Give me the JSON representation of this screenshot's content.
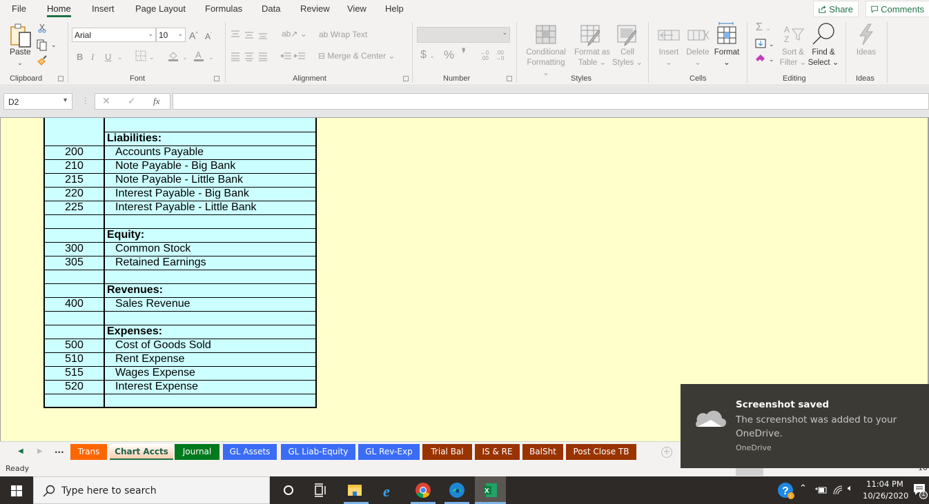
{
  "menu": {
    "tabs": [
      "File",
      "Home",
      "Insert",
      "Page Layout",
      "Formulas",
      "Data",
      "Review",
      "View",
      "Help"
    ],
    "active": "Home",
    "share_label": "Share",
    "comments_label": "Comments"
  },
  "ribbon": {
    "clipboard": {
      "paste_label": "Paste",
      "group_label": "Clipboard"
    },
    "font": {
      "font_name": "Arial",
      "font_size": "10",
      "group_label": "Font"
    },
    "alignment": {
      "wrap_text_label": "Wrap Text",
      "merge_center_label": "Merge & Center",
      "group_label": "Alignment"
    },
    "number": {
      "format_value": "",
      "currency_symbol": "$",
      "percent_symbol": "%",
      "comma_symbol": "❜",
      "group_label": "Number"
    },
    "styles": {
      "conditional_formatting_label_1": "Conditional",
      "conditional_formatting_label_2": "Formatting",
      "format_as_table_label_1": "Format as",
      "format_as_table_label_2": "Table",
      "cell_styles_label_1": "Cell",
      "cell_styles_label_2": "Styles",
      "group_label": "Styles"
    },
    "cells": {
      "insert_label": "Insert",
      "delete_label": "Delete",
      "format_label": "Format",
      "group_label": "Cells"
    },
    "editing": {
      "sort_filter_label_1": "Sort &",
      "sort_filter_label_2": "Filter",
      "find_select_label_1": "Find &",
      "find_select_label_2": "Select",
      "group_label": "Editing"
    },
    "ideas": {
      "ideas_label": "Ideas",
      "group_label": "Ideas"
    }
  },
  "formula_bar": {
    "name_box": "D2",
    "cancel_symbol": "✕",
    "enter_symbol": "✓",
    "fx_symbol": "fx",
    "formula_value": ""
  },
  "sheet": {
    "background_color": "#ffffcc",
    "table_color": "#ccffff",
    "rows": [
      {
        "num": "",
        "name": "",
        "type": "blank"
      },
      {
        "num": "",
        "name": "Liabilities:",
        "type": "header"
      },
      {
        "num": "200",
        "name": "Accounts Payable",
        "type": "account"
      },
      {
        "num": "210",
        "name": "Note Payable - Big Bank",
        "type": "account"
      },
      {
        "num": "215",
        "name": "Note Payable - Little Bank",
        "type": "account"
      },
      {
        "num": "220",
        "name": "Interest Payable - Big Bank",
        "type": "account"
      },
      {
        "num": "225",
        "name": "Interest Payable - Little Bank",
        "type": "account"
      },
      {
        "num": "",
        "name": "",
        "type": "blank"
      },
      {
        "num": "",
        "name": "Equity:",
        "type": "header"
      },
      {
        "num": "300",
        "name": "Common Stock",
        "type": "account"
      },
      {
        "num": "305",
        "name": "Retained Earnings",
        "type": "account"
      },
      {
        "num": "",
        "name": "",
        "type": "blank"
      },
      {
        "num": "",
        "name": "Revenues:",
        "type": "header"
      },
      {
        "num": "400",
        "name": "Sales Revenue",
        "type": "account"
      },
      {
        "num": "",
        "name": "",
        "type": "blank"
      },
      {
        "num": "",
        "name": "Expenses:",
        "type": "header"
      },
      {
        "num": "500",
        "name": "Cost of Goods Sold",
        "type": "account"
      },
      {
        "num": "510",
        "name": "Rent Expense",
        "type": "account"
      },
      {
        "num": "515",
        "name": "Wages Expense",
        "type": "account"
      },
      {
        "num": "520",
        "name": "Interest Expense",
        "type": "account"
      },
      {
        "num": "",
        "name": "",
        "type": "blank"
      }
    ]
  },
  "sheet_tabs": {
    "ellipsis": "...",
    "tabs": [
      {
        "label": "Trans",
        "color": "#ff6600",
        "active": false
      },
      {
        "label": "Chart Accts",
        "color": "#f8cfb0",
        "active": true
      },
      {
        "label": "Journal",
        "color": "#007a1c",
        "active": false
      },
      {
        "label": "GL Assets",
        "color": "#3b6cf5",
        "active": false
      },
      {
        "label": "GL Liab-Equity",
        "color": "#3b6cf5",
        "active": false
      },
      {
        "label": "GL Rev-Exp",
        "color": "#3b6cf5",
        "active": false
      },
      {
        "label": "Trial Bal",
        "color": "#993300",
        "active": false
      },
      {
        "label": "IS & RE",
        "color": "#993300",
        "active": false
      },
      {
        "label": "BalSht",
        "color": "#993300",
        "active": false
      },
      {
        "label": "Post Close TB",
        "color": "#993300",
        "active": false
      }
    ],
    "add_symbol": "+"
  },
  "status_bar": {
    "status": "Ready",
    "zoom_partial": "10"
  },
  "toast": {
    "title": "Screenshot saved",
    "body": "The screenshot was added to your OneDrive.",
    "app": "OneDrive"
  },
  "taskbar": {
    "search_placeholder": "Type here to search",
    "time": "11:04 PM",
    "date": "10/26/2020",
    "notification_count": "1"
  }
}
